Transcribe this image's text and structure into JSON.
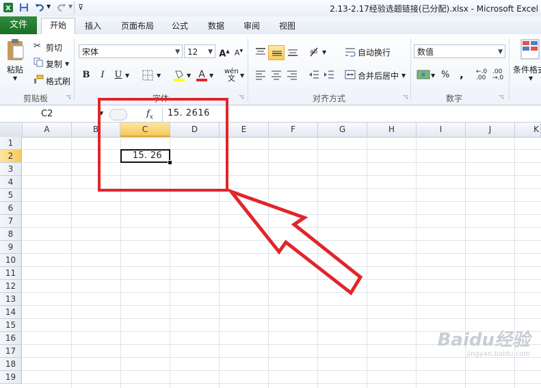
{
  "titlebar": {
    "title": "2.13-2.17经验选题链接(已分配).xlsx  -  Microsoft Excel"
  },
  "quick_access": {
    "icons": [
      "excel-icon",
      "save-icon",
      "undo-icon",
      "redo-icon",
      "customize-icon"
    ]
  },
  "tabs": {
    "file": "文件",
    "items": [
      "开始",
      "插入",
      "页面布局",
      "公式",
      "数据",
      "审阅",
      "视图"
    ],
    "active": "开始"
  },
  "ribbon": {
    "clipboard": {
      "paste": "粘贴",
      "cut": "剪切",
      "copy": "复制",
      "format_painter": "格式刷",
      "label": "剪贴板"
    },
    "font": {
      "family": "宋体",
      "size": "12",
      "bold": "B",
      "italic": "I",
      "underline": "U",
      "wen": "wén",
      "label": "字体"
    },
    "alignment": {
      "wrap": "自动换行",
      "merge": "合并后居中",
      "label": "对齐方式"
    },
    "number": {
      "format": "数值",
      "percent": "%",
      "comma": ",",
      "label": "数字"
    },
    "styles": {
      "conditional": "条件格式"
    }
  },
  "formula_bar": {
    "name_box": "C2",
    "fx": "fx",
    "value": "15. 2616"
  },
  "grid": {
    "columns": [
      "A",
      "B",
      "C",
      "D",
      "E",
      "F",
      "G",
      "H",
      "I",
      "J",
      "K"
    ],
    "rows": [
      "1",
      "2",
      "3",
      "4",
      "5",
      "6",
      "7",
      "8",
      "9",
      "10",
      "11",
      "12",
      "13",
      "14",
      "15",
      "16",
      "17",
      "18",
      "19"
    ],
    "active_column": "C",
    "active_row": "2",
    "active_cell_display": "15. 26"
  },
  "annotation": {
    "box_color": "#e0262a",
    "arrow_color": "#e0262a"
  },
  "watermark": {
    "brand": "Baidu经验",
    "url": "jingyan.baidu.com"
  }
}
